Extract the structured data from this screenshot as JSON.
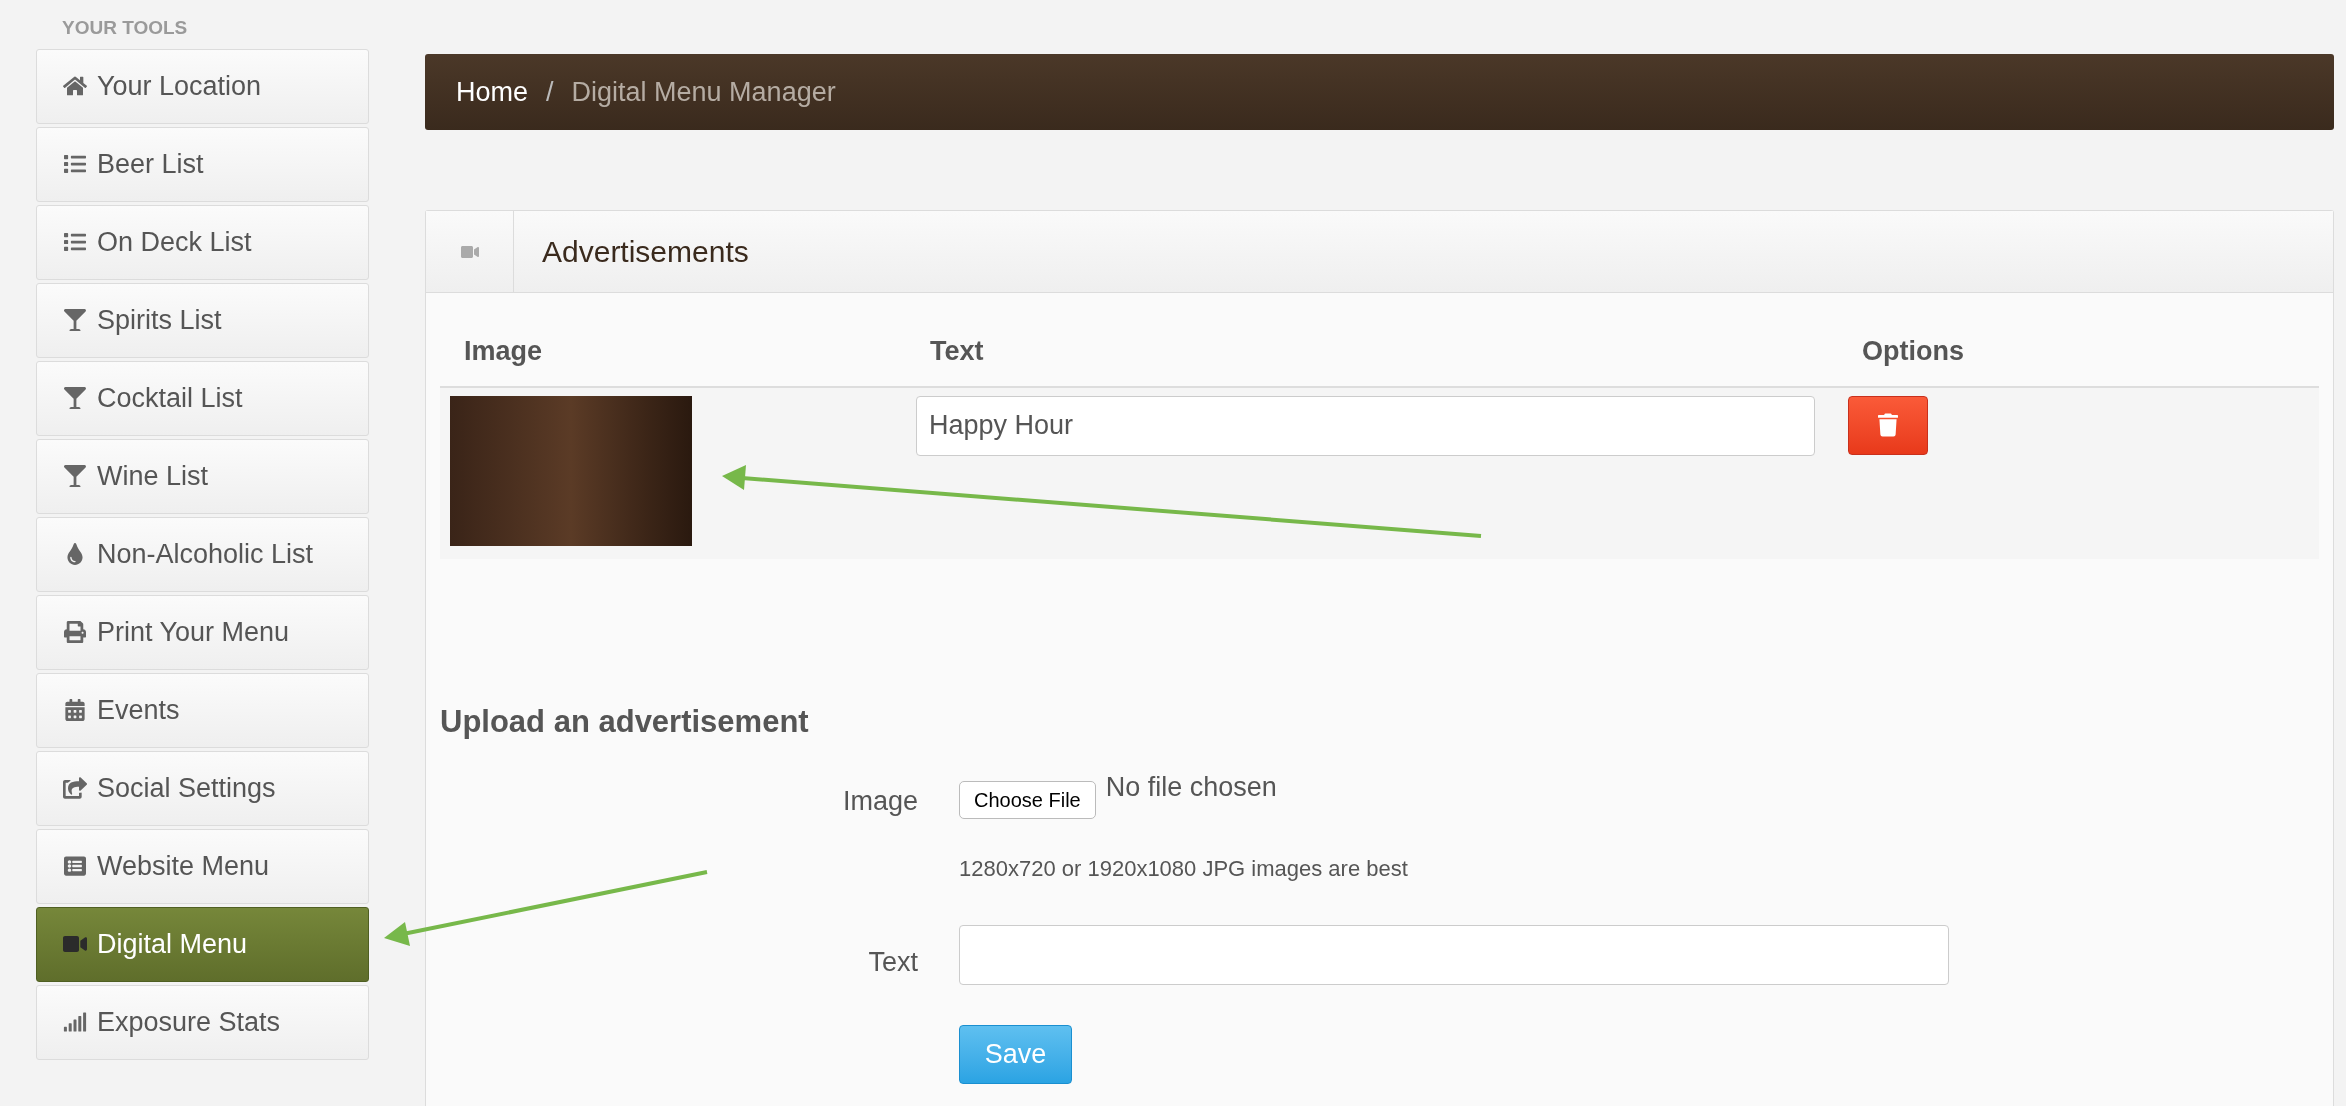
{
  "sidebar": {
    "heading": "YOUR TOOLS",
    "items": [
      {
        "label": "Your Location",
        "selected": false
      },
      {
        "label": "Beer List",
        "selected": false
      },
      {
        "label": "On Deck List",
        "selected": false
      },
      {
        "label": "Spirits List",
        "selected": false
      },
      {
        "label": "Cocktail List",
        "selected": false
      },
      {
        "label": "Wine List",
        "selected": false
      },
      {
        "label": "Non-Alcoholic List",
        "selected": false
      },
      {
        "label": "Print Your Menu",
        "selected": false
      },
      {
        "label": "Events",
        "selected": false
      },
      {
        "label": "Social Settings",
        "selected": false
      },
      {
        "label": "Website Menu",
        "selected": false
      },
      {
        "label": "Digital Menu",
        "selected": true
      },
      {
        "label": "Exposure Stats",
        "selected": false
      }
    ]
  },
  "breadcrumb_separator": "/",
  "breadcrumb": [
    {
      "label": "Home",
      "current": false
    },
    {
      "label": "Digital Menu Manager",
      "current": true
    }
  ],
  "panel": {
    "title": "Advertisements",
    "table": {
      "columns": [
        "Image",
        "Text",
        "Options"
      ],
      "rows": [
        {
          "text": "Happy Hour"
        }
      ]
    }
  },
  "upload": {
    "heading": "Upload an advertisement",
    "image_label": "Image",
    "file_button": "Choose File",
    "file_status": "No file chosen",
    "hint": "1280x720 or 1920x1080 JPG images are best",
    "text_label": "Text",
    "save": "Save"
  }
}
